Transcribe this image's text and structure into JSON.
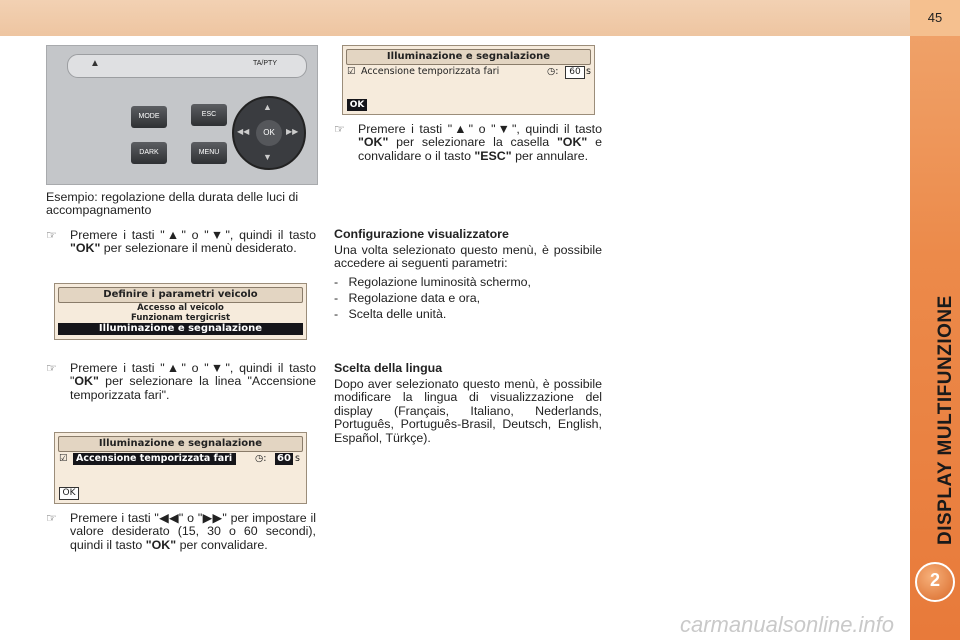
{
  "page_number": "45",
  "side_title": "DISPLAY MULTIFUNZIONE",
  "chapter_number": "2",
  "watermark": "carmanualsonline.info",
  "radio": {
    "ta_pty": "TA/PTY",
    "mode": "MODE",
    "dark": "DARK",
    "esc": "ESC",
    "menu": "MENU",
    "ok": "OK",
    "rewind": "◀◀",
    "forward": "▶▶",
    "up": "▲",
    "down": "▼",
    "eject": "▲"
  },
  "caption": "Esempio: regolazione della durata delle luci di accompagnamento",
  "left_col": {
    "bullet1": {
      "icon": "☞",
      "pre": "Premere i tasti \"▲\" o \"▼\", quindi il tasto ",
      "key": "\"OK\"",
      "post": " per selezionare il menù desiderato."
    },
    "screen1": {
      "title": "Definire i parametri veicolo",
      "item1": "Accesso al veicolo",
      "item2": "Funzionam tergicrist",
      "selected": "Illuminazione e segnalazione"
    },
    "bullet2": {
      "icon": "☞",
      "pre": "Premere i tasti \"▲\" o \"▼\", quindi il tasto \"",
      "key": "OK\"",
      "post": " per selezionare la linea \"Accensione temporizzata fari\"."
    },
    "screen2": {
      "title": "Illuminazione e segnalazione",
      "row": "Accensione temporizzata fari",
      "value": "60",
      "unit": "s",
      "ok": "OK",
      "checkbox": "☑",
      "clock": "◷:"
    },
    "bullet3": {
      "icon": "☞",
      "pre": "Premere i tasti \"◀◀\" o \"▶▶\" per impostare il valore desiderato (15, 30 o 60 secondi), quindi il tasto ",
      "key": "\"OK\"",
      "post": " per convalidare."
    }
  },
  "right_col": {
    "screen3": {
      "title": "Illuminazione e segnalazione",
      "row": "Accensione temporizzata fari",
      "value": "60",
      "unit": "s",
      "ok": "OK",
      "checkbox": "☑",
      "clock": "◷:"
    },
    "bullet1": {
      "icon": "☞",
      "pre": "Premere i tasti \"▲\" o \"▼\", quindi il tasto ",
      "key1": "\"OK\"",
      "mid": " per selezionare la casella ",
      "key2": "\"OK\"",
      "mid2": " e convalidare o il tasto ",
      "key3": "\"ESC\"",
      "post": " per annulare."
    },
    "config": {
      "heading": "Configurazione visualizzatore",
      "intro": "Una volta selezionato questo menù, è possibile accedere ai seguenti parametri:",
      "items": [
        "Regolazione luminosità schermo,",
        "Regolazione data e ora,",
        "Scelta delle unità."
      ]
    },
    "lingua": {
      "heading": "Scelta della lingua",
      "body": "Dopo aver selezionato questo menù, è possibile modificare la lingua di visualizzazione del display (Français, Italiano, Nederlands, Português, Português-Brasil, Deutsch, English, Español, Türkçe)."
    }
  }
}
